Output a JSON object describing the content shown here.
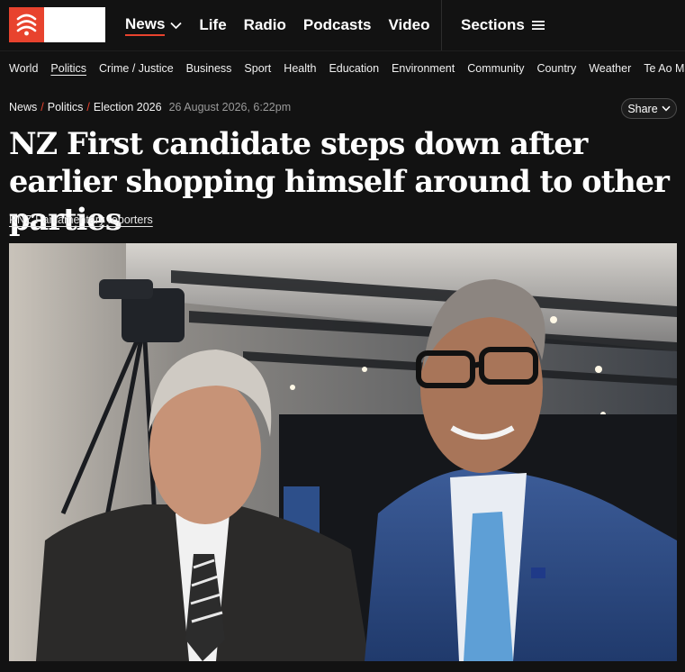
{
  "brand": {
    "accent": "#e8432e",
    "logo_icon": "rnz-logo-icon"
  },
  "nav": {
    "primary": [
      {
        "label": "News",
        "active": true,
        "has_dropdown": true
      },
      {
        "label": "Life"
      },
      {
        "label": "Radio"
      },
      {
        "label": "Podcasts"
      },
      {
        "label": "Video"
      }
    ],
    "sections_label": "Sections",
    "secondary": [
      {
        "label": "World"
      },
      {
        "label": "Politics",
        "active": true
      },
      {
        "label": "Crime / Justice"
      },
      {
        "label": "Business"
      },
      {
        "label": "Sport"
      },
      {
        "label": "Health"
      },
      {
        "label": "Education"
      },
      {
        "label": "Environment"
      },
      {
        "label": "Community"
      },
      {
        "label": "Country"
      },
      {
        "label": "Weather"
      },
      {
        "label": "Te Ao Māori"
      }
    ]
  },
  "article": {
    "breadcrumbs": [
      "News",
      "Politics",
      "Election 2026"
    ],
    "date": "26 August 2026, 6:22pm",
    "share_label": "Share",
    "headline": "NZ First candidate steps down after earlier shopping himself around to other parties",
    "byline": "RNZ Parliamentary reporters",
    "image_icon": "article-photo"
  }
}
